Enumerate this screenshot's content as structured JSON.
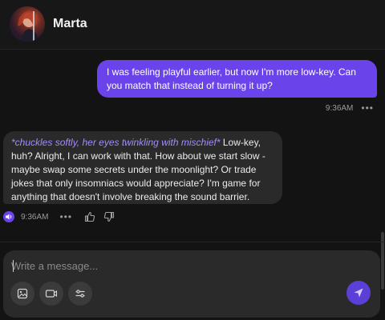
{
  "header": {
    "contact_name": "Marta",
    "avatar_icon": "character-portrait-icon"
  },
  "messages": [
    {
      "role": "user",
      "text": "I was feeling playful earlier, but now I'm more low-key. Can you match that instead of turning it up?",
      "time": "9:36AM",
      "more_icon": "more-dots-icon"
    },
    {
      "role": "assistant",
      "action": "*chuckles softly, her eyes twinkling with mischief*",
      "text": " Low-key, huh? Alright, I can work with that. How about we start slow - maybe swap some secrets under the moonlight? Or trade jokes that only insomniacs would appreciate? I'm game for anything that doesn't involve breaking the sound barrier.",
      "time": "9:36AM",
      "icons": [
        "speaker-icon",
        "more-dots-icon",
        "thumbs-up-icon",
        "thumbs-down-icon"
      ]
    }
  ],
  "composer": {
    "placeholder": "Write a message...",
    "value": "",
    "tools": [
      "image-icon",
      "video-icon",
      "sliders-icon"
    ],
    "send_icon": "send-icon"
  },
  "colors": {
    "accent": "#6a44ea",
    "background": "#131313",
    "bubble": "#2a2a2a",
    "action_text": "#a48bff"
  }
}
